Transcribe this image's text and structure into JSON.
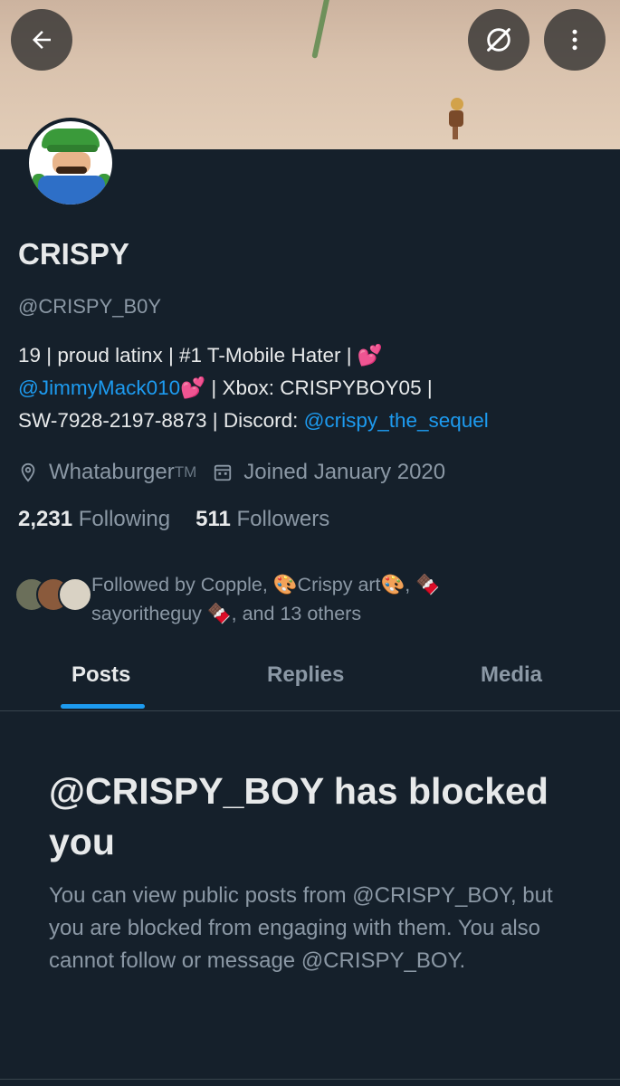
{
  "profile": {
    "display_name": "CRISPY",
    "handle": "@CRISPY_B0Y",
    "bio": {
      "line1_text": "19 | proud latinx | #1 T-Mobile Hater | ",
      "line1_emoji": "💕",
      "line2_mention": "@JimmyMack010",
      "line2_emoji": "💕",
      "line2_rest": " | Xbox: CRISPYBOY05 |",
      "line3_text": "SW-7928-2197-8873 | Discord: ",
      "line3_link": "@crispy_the_sequel"
    },
    "location": "Whataburger",
    "location_suffix": "TM",
    "joined": "Joined January 2020",
    "following_count": "2,231",
    "following_label": "Following",
    "followers_count": "511",
    "followers_label": "Followers",
    "followed_by_line1": "Followed by Copple, 🎨Crispy art🎨, 🍫",
    "followed_by_line2": "sayoritheguy 🍫, and 13 others"
  },
  "tabs": [
    {
      "label": "Posts",
      "active": true
    },
    {
      "label": "Replies",
      "active": false
    },
    {
      "label": "Media",
      "active": false
    }
  ],
  "blocked": {
    "title": "@CRISPY_BOY has blocked you",
    "description": "You can view public posts from @CRISPY_BOY, but you are blocked from engaging with them. You also cannot follow or message @CRISPY_BOY."
  },
  "icons": {
    "back": "arrow-left-icon",
    "grok": "grok-icon",
    "more": "more-vertical-icon",
    "location": "location-pin-icon",
    "calendar": "calendar-icon"
  },
  "colors": {
    "background": "#15202b",
    "accent": "#1d9bf0",
    "secondary_text": "#8b98a5",
    "primary_text": "#e7e9ea"
  }
}
